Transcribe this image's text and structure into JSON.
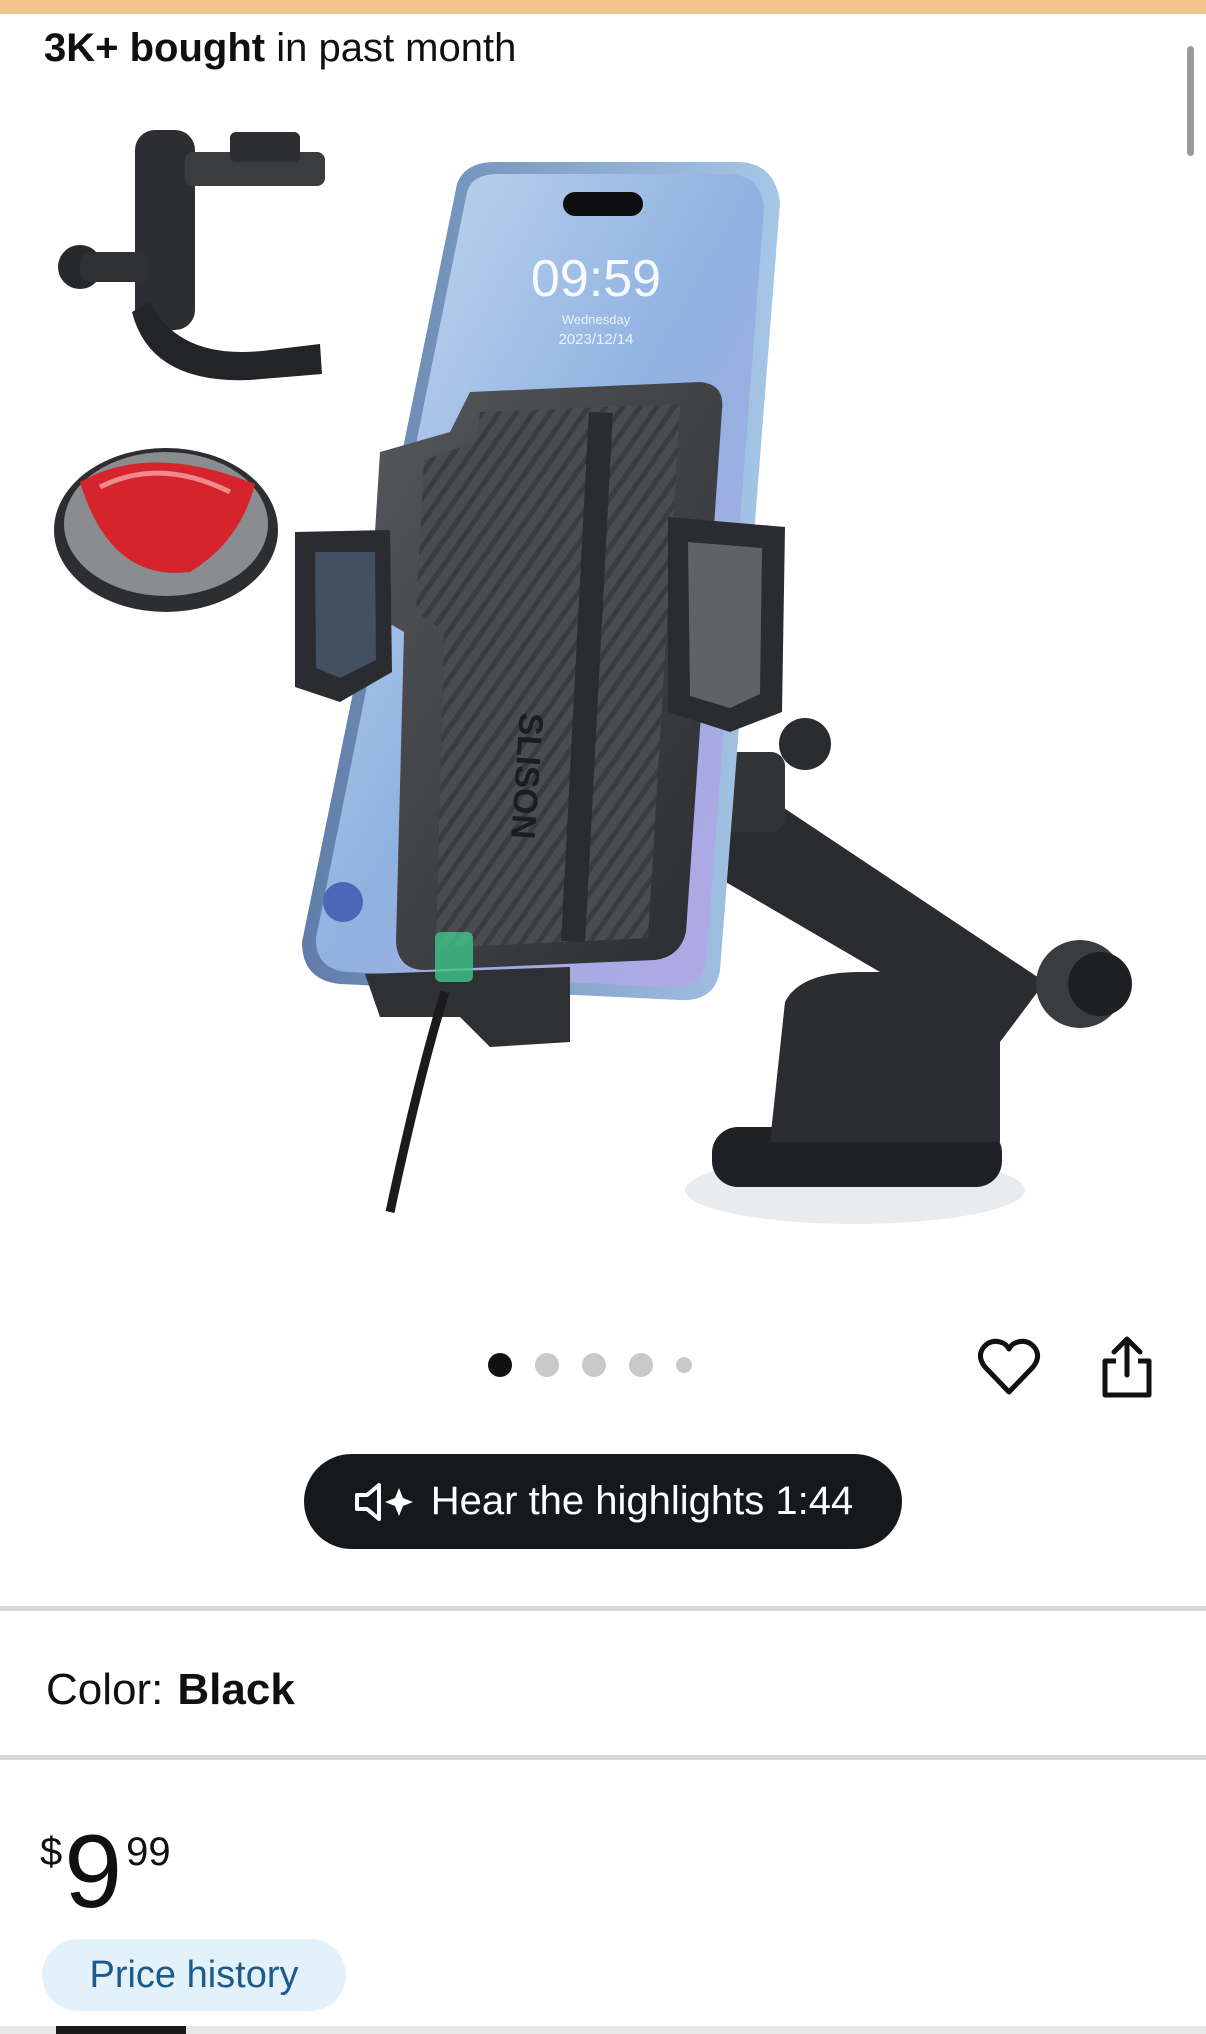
{
  "header": {
    "bought_strong": "3K+ bought",
    "bought_rest": " in past month"
  },
  "gallery": {
    "image_alt": "Car phone mount with air-vent clip and adhesive pad",
    "phone_time": "09:59",
    "phone_day": "Wednesday",
    "phone_date": "2023/12/14",
    "brand_text": "SLISON",
    "dot_count": 5,
    "active_index": 0
  },
  "highlights": {
    "label": "Hear the highlights 1:44"
  },
  "variant": {
    "label": "Color:",
    "value": "Black"
  },
  "price": {
    "currency": "$",
    "whole": "9",
    "fraction": "99"
  },
  "price_history": {
    "label": "Price history"
  },
  "colors": {
    "accent_top": "#f3c48a",
    "pill_bg": "#16191c",
    "price_history_bg": "#e3f1fb",
    "price_history_text": "#1d5a8a"
  },
  "icons": [
    "heart-icon",
    "share-icon",
    "speaker-sparkle-icon"
  ]
}
